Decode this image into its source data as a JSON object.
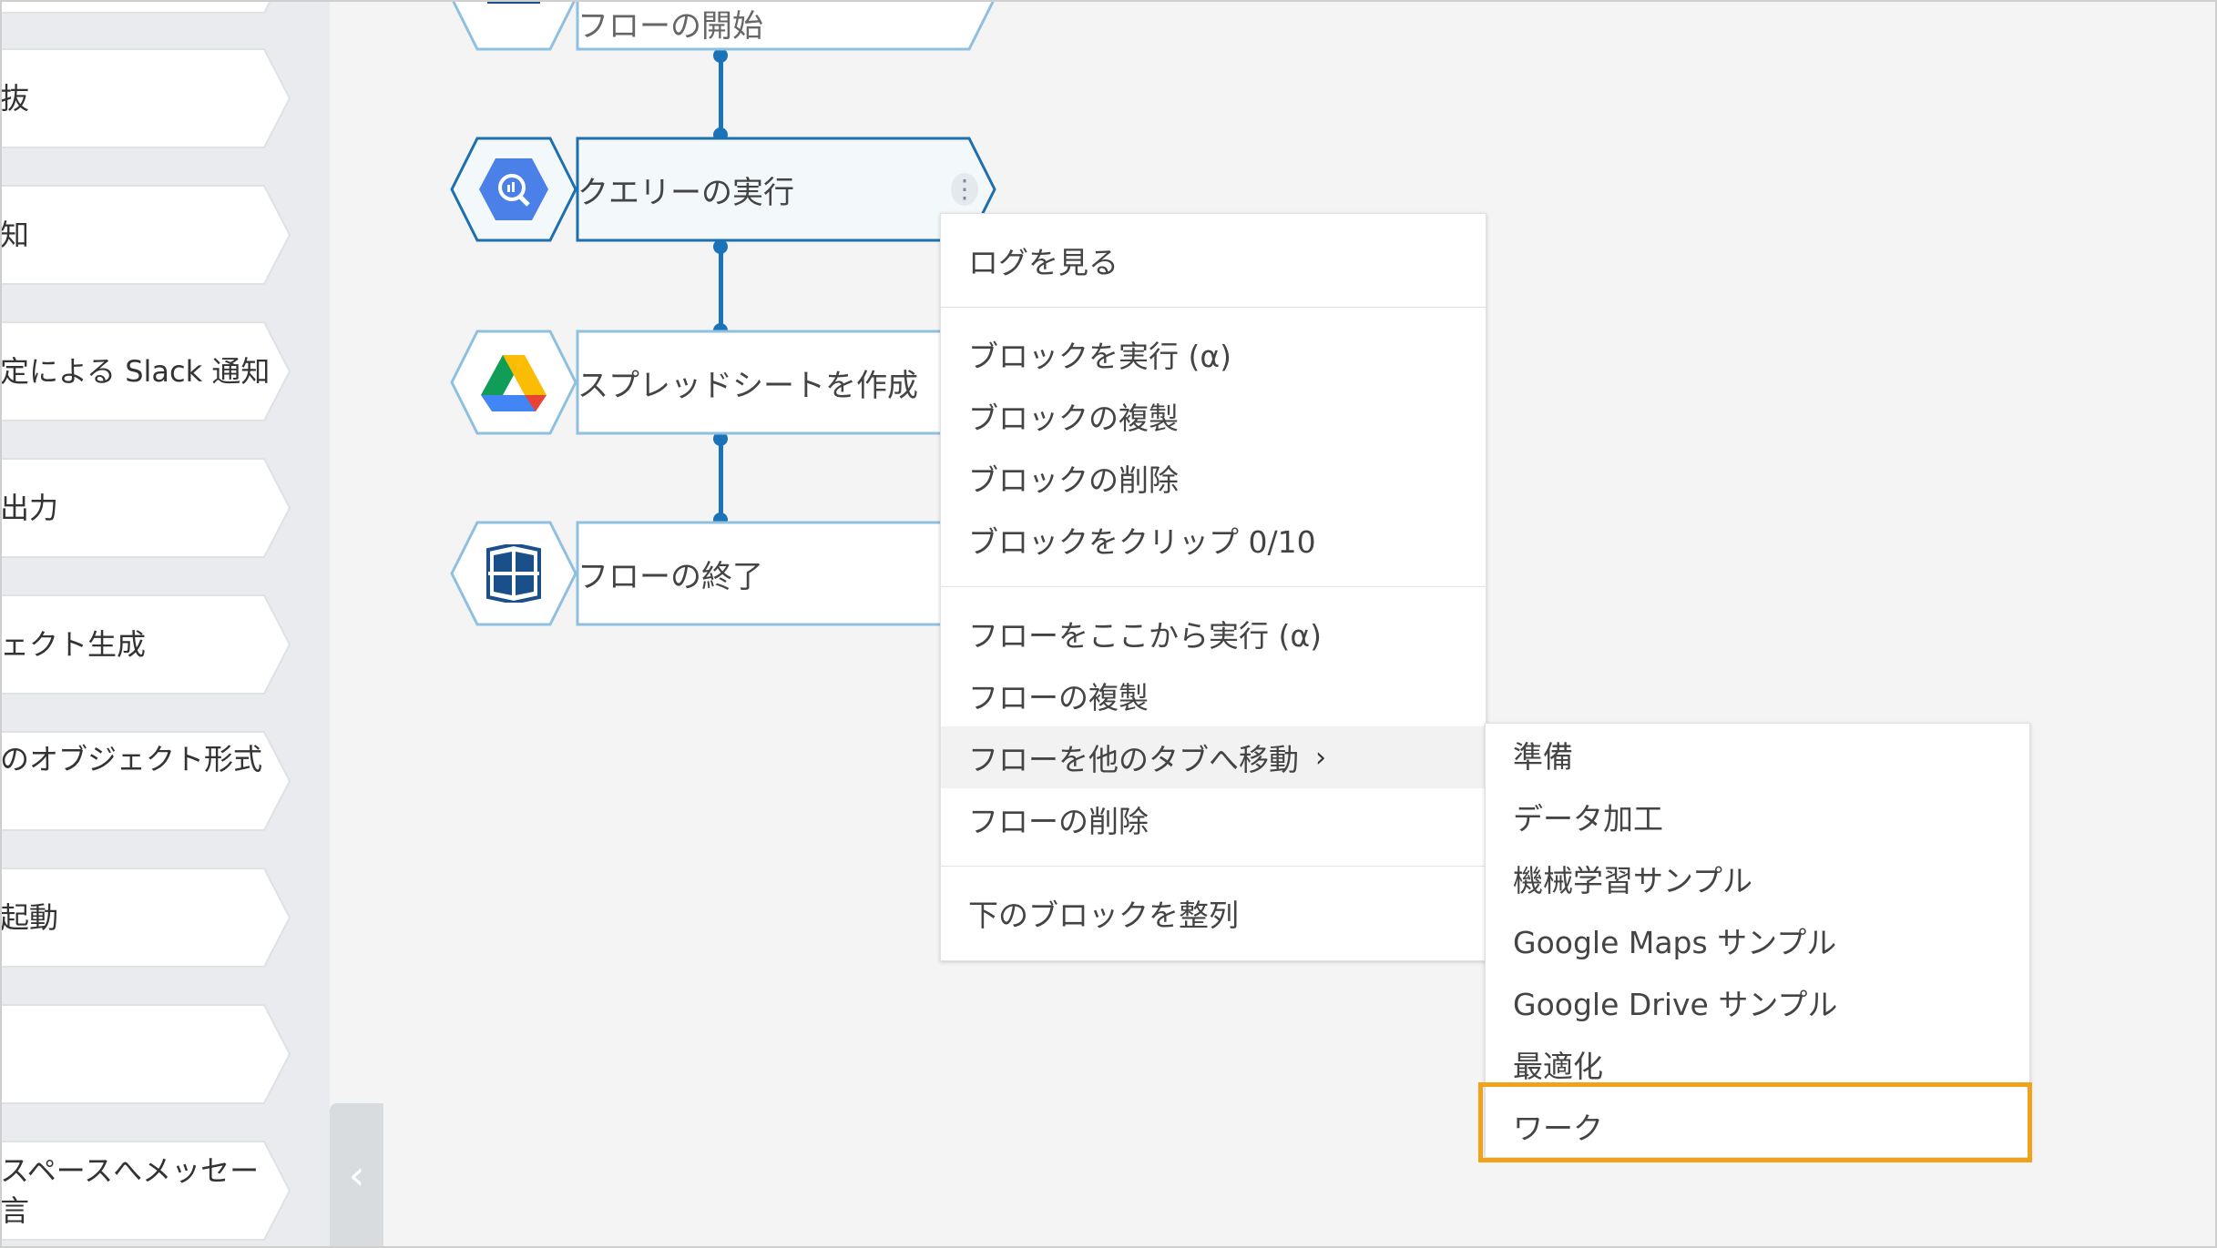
{
  "palette": {
    "items": [
      {
        "label": "",
        "label2": ""
      },
      {
        "label": "抜",
        "label2": ""
      },
      {
        "label": "知",
        "label2": ""
      },
      {
        "label": "定による Slack 通知",
        "label2": ""
      },
      {
        "label": "出力",
        "label2": ""
      },
      {
        "label": "ェクト生成",
        "label2": ""
      },
      {
        "label": "のオブジェクト形式",
        "label2": ""
      },
      {
        "label": "起動",
        "label2": ""
      },
      {
        "label": "",
        "label2": ""
      },
      {
        "label": "スペースへメッセー",
        "label2": "言"
      }
    ],
    "collapse_icon": "chevron-left-icon",
    "collapse_glyph": "‹"
  },
  "canvas": {
    "blocks": [
      {
        "label": "フローの開始",
        "icon": "flow-logo-icon"
      },
      {
        "label": "クエリーの実行",
        "icon": "bigquery-icon",
        "menu_glyph": "⋮"
      },
      {
        "label": "スプレッドシートを作成",
        "icon": "google-drive-icon"
      },
      {
        "label": "フローの終了",
        "icon": "flow-logo-icon"
      }
    ],
    "colors": {
      "connector": "#1a73b8",
      "block_border": "#2a84c6",
      "selected_fill": "#f3f8fb"
    }
  },
  "context_menu": {
    "groups": [
      [
        "ログを見る"
      ],
      [
        "ブロックを実行 (α)",
        "ブロックの複製",
        "ブロックの削除",
        "ブロックをクリップ 0/10"
      ],
      [
        "フローをここから実行 (α)",
        "フローの複製",
        "フローを他のタブへ移動",
        "フローの削除"
      ],
      [
        "下のブロックを整列"
      ]
    ],
    "submenu_chevron": "›"
  },
  "submenu": {
    "items": [
      "準備",
      "データ加工",
      "機械学習サンプル",
      "Google Maps サンプル",
      "Google Drive サンプル",
      "最適化",
      "ワーク"
    ],
    "highlight_color": "#f0a21a"
  }
}
